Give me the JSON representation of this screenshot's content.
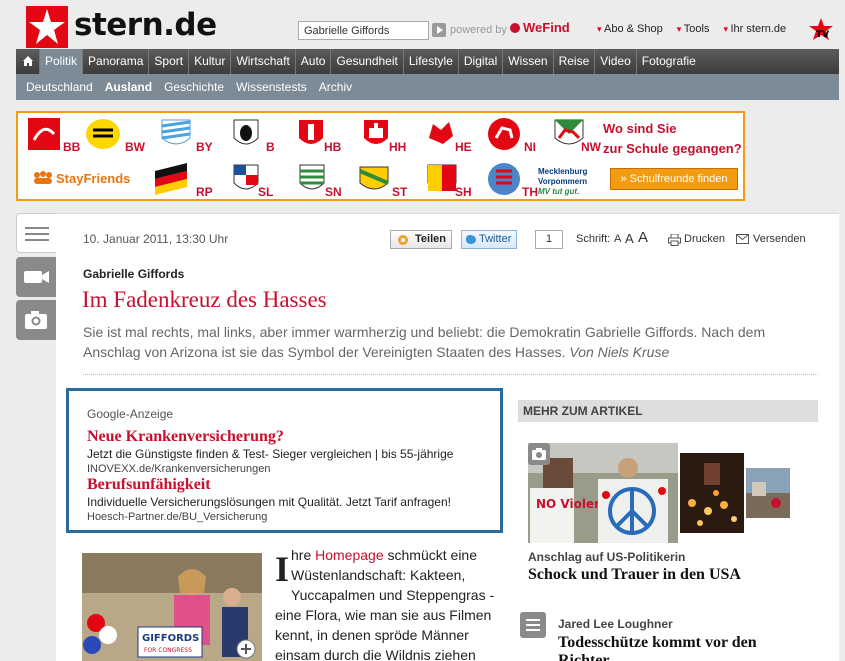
{
  "header": {
    "logo_text": "stern.de",
    "search_value": "Gabrielle Giffords",
    "powered_by": "powered by",
    "wefind": "WeFind",
    "links": [
      "Abo & Shop",
      "Tools",
      "Ihr stern.de"
    ]
  },
  "mainnav": [
    "Politik",
    "Panorama",
    "Sport",
    "Kultur",
    "Wirtschaft",
    "Auto",
    "Gesundheit",
    "Lifestyle",
    "Digital",
    "Wissen",
    "Reise",
    "Video",
    "Fotografie"
  ],
  "subnav": [
    "Deutschland",
    "Ausland",
    "Geschichte",
    "Wissenstests",
    "Archiv"
  ],
  "banner": {
    "row1": [
      "BB",
      "BW",
      "BY",
      "B",
      "HB",
      "HH",
      "HE",
      "NI",
      "NW"
    ],
    "row2": [
      "RP",
      "SL",
      "SN",
      "ST",
      "SH",
      "TH"
    ],
    "question_line1": "Wo sind Sie",
    "question_line2": "zur Schule gegangen?",
    "stayfriends": "StayFriends",
    "mv_line1": "Mecklenburg",
    "mv_line2": "Vorpommern",
    "mv_line3": "MV tut gut.",
    "button": "» Schulfreunde finden"
  },
  "article": {
    "date": "10. Januar 2011, 13:30 Uhr",
    "share": "Teilen",
    "twitter": "Twitter",
    "twitter_count": "1",
    "schrift": "Schrift:",
    "font_sizes": [
      "A",
      "A",
      "A"
    ],
    "print": "Drucken",
    "send": "Versenden",
    "kicker": "Gabrielle Giffords",
    "headline": "Im Fadenkreuz des Hasses",
    "teaser": "Sie ist mal rechts, mal links, aber immer warmherzig und beliebt: die Demokratin Gabrielle Giffords. Nach dem Anschlag von Arizona ist sie das Symbol der Vereinigten Staaten des Hasses.",
    "author": "Von Niels Kruse",
    "dropcap": "I",
    "body_lines": [
      {
        "pre": "hre ",
        "link": "Homepage",
        "post": " schmückt eine"
      },
      {
        "pre": "Wüstenlandschaft: Kakteen,",
        "link": "",
        "post": ""
      },
      {
        "pre": "Yuccapalmen und Steppengras -",
        "link": "",
        "post": ""
      },
      {
        "pre": "eine Flora, wie man sie aus Filmen",
        "link": "",
        "post": ""
      },
      {
        "pre": "kennt, in denen spröde Männer",
        "link": "",
        "post": ""
      },
      {
        "pre": "einsam durch die Wildnis ziehen",
        "link": "",
        "post": ""
      }
    ],
    "image_sign": "GIFFORDS",
    "image_sign_sub": "FOR CONGRESS"
  },
  "google_ad": {
    "label": "Google-Anzeige",
    "ads": [
      {
        "title": "Neue Krankenversicherung?",
        "desc": "Jetzt die Günstigste finden & Test- Sieger vergleichen | bis 55-jährige",
        "url": "INOVEXX.de/Krankenversicherungen"
      },
      {
        "title": "Berufsunfähigkeit",
        "desc": "Individuelle Versicherungslösungen mit Qualität. Jetzt Tarif anfragen!",
        "url": "Hoesch-Partner.de/BU_Versicherung"
      }
    ]
  },
  "side": {
    "heading": "MEHR ZUM ARTIKEL",
    "items": [
      {
        "kicker": "Anschlag auf US-Politikerin",
        "title": "Schock und Trauer in den USA"
      },
      {
        "kicker": "Jared Lee Loughner",
        "title": "Todesschütze kommt vor den Richter"
      }
    ],
    "sign_text": "NO Violence"
  },
  "colors": {
    "brand_red": "#e30613",
    "headline_red": "#c8102e",
    "nav_dark": "#4a4a4a",
    "subnav": "#7d8b96",
    "ad_border": "#2a6c9c",
    "banner_border": "#f39c12"
  }
}
